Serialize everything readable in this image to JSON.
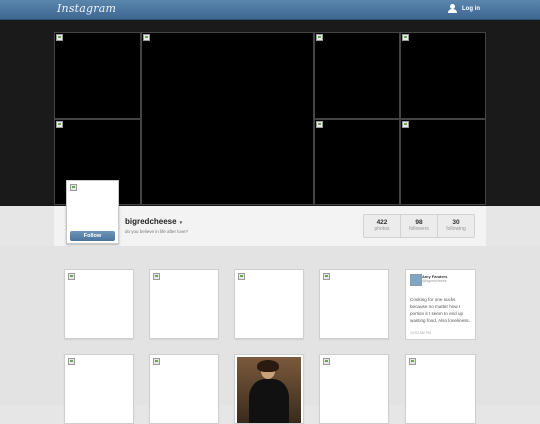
{
  "header": {
    "logo_text": "Instagram",
    "login_label": "Log in",
    "icons": {
      "user": "user-icon"
    }
  },
  "profile": {
    "username": "bigredcheese",
    "caret": "▾",
    "bio": "do you believe in life after love?",
    "follow_label": "Follow",
    "stats": [
      {
        "value": "422",
        "label": "photos"
      },
      {
        "value": "98",
        "label": "followers"
      },
      {
        "value": "30",
        "label": "following"
      }
    ]
  },
  "tweet": {
    "name": "Amy Fanders",
    "handle": "@bigredcheese",
    "text": "Cooking for one sucks because no matter how I portion it I seem to end up wasting food. Also loneliness.",
    "time": "10:53 AM PM"
  },
  "colors": {
    "topbar": "#4a739c",
    "follow_button": "#5a83ad",
    "header_background": "#1a1a1a"
  }
}
